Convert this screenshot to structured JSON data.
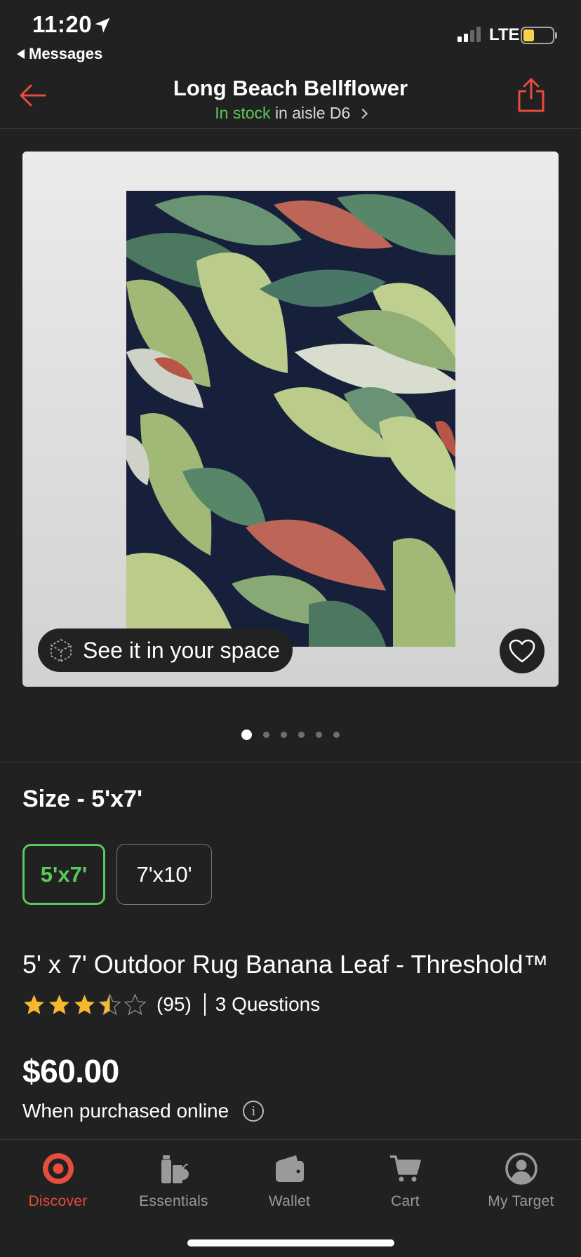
{
  "status_bar": {
    "time": "11:20",
    "back_app": "Messages",
    "carrier": "LTE"
  },
  "header": {
    "title": "Long Beach Bellflower",
    "stock_status": "In stock",
    "aisle_text": "in aisle D6"
  },
  "gallery": {
    "see_in_space_label": "See it in your space",
    "image_count": 6,
    "active_index": 0
  },
  "size": {
    "heading": "Size - 5'x7'",
    "options": [
      "5'x7'",
      "7'x10'"
    ],
    "selected": "5'x7'"
  },
  "product": {
    "title": "5' x 7' Outdoor Rug Banana Leaf - Threshold™",
    "rating": 3.5,
    "rating_max": 5,
    "review_count": "(95)",
    "questions": "3 Questions",
    "price": "$60.00",
    "price_note": "When purchased online"
  },
  "tab_bar": {
    "tabs": [
      {
        "label": "Discover",
        "icon": "target-logo-icon",
        "active": true
      },
      {
        "label": "Essentials",
        "icon": "essentials-icon",
        "active": false
      },
      {
        "label": "Wallet",
        "icon": "wallet-icon",
        "active": false
      },
      {
        "label": "Cart",
        "icon": "cart-icon",
        "active": false
      },
      {
        "label": "My Target",
        "icon": "profile-icon",
        "active": false
      }
    ]
  },
  "colors": {
    "accent_red": "#e74c3c",
    "stock_green": "#5ac85a",
    "background": "#212121",
    "star_gold": "#f5b82e"
  }
}
